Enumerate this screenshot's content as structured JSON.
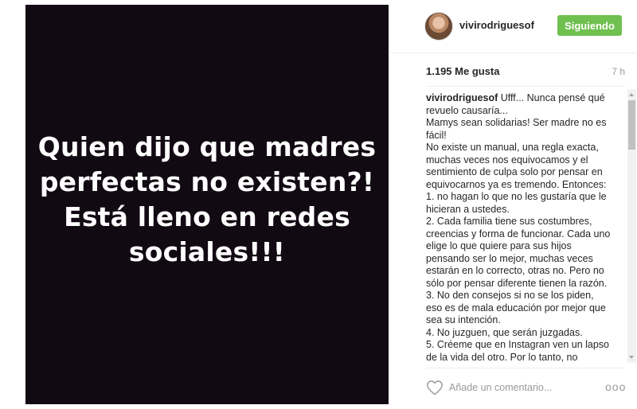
{
  "media": {
    "text_lines": [
      "Quien dijo que madres",
      "perfectas no existen?!",
      "Está lleno en redes",
      "sociales!!!"
    ],
    "background_color": "#120a12"
  },
  "header": {
    "username": "vivirodriguesof",
    "follow_label": "Siguiendo",
    "follow_color": "#70c050",
    "avatar_icon": "profile-photo"
  },
  "stats": {
    "likes": "1.195 Me gusta",
    "time": "7 h"
  },
  "caption": {
    "username": "vivirodriguesof",
    "first_line_rest": " Ufff... Nunca pensé qué",
    "lines": [
      "revuelo causaría...",
      "Mamys sean solidarias! Ser madre no es",
      "fácil!",
      "No existe un manual, una regla exacta,",
      "muchas veces nos equivocamos y el",
      "sentimiento de culpa solo por pensar en",
      "equivocarnos ya es tremendo. Entonces:",
      "1. no hagan lo que no les gustaría que le",
      "hicieran a ustedes.",
      "2. Cada familia tiene sus costumbres,",
      "creencias y forma de funcionar. Cada uno",
      "elige lo que quiere para sus hijos",
      "pensando ser lo mejor, muchas veces",
      "estarán en lo correcto, otras no. Pero no",
      "sólo por pensar diferente tienen la razón.",
      "3. No den consejos si no se los piden,",
      "eso es de mala educación por mejor que",
      "sea su intención.",
      "4. No juzguen, que serán juzgadas.",
      "5. Créeme que en Instagran ven un lapso",
      "de la vida del otro. Por lo tanto, no"
    ]
  },
  "comment": {
    "placeholder": "Añade un comentario...",
    "heart_icon": "heart-outline",
    "more_icon": "more-options",
    "more_glyph": "ooo"
  }
}
